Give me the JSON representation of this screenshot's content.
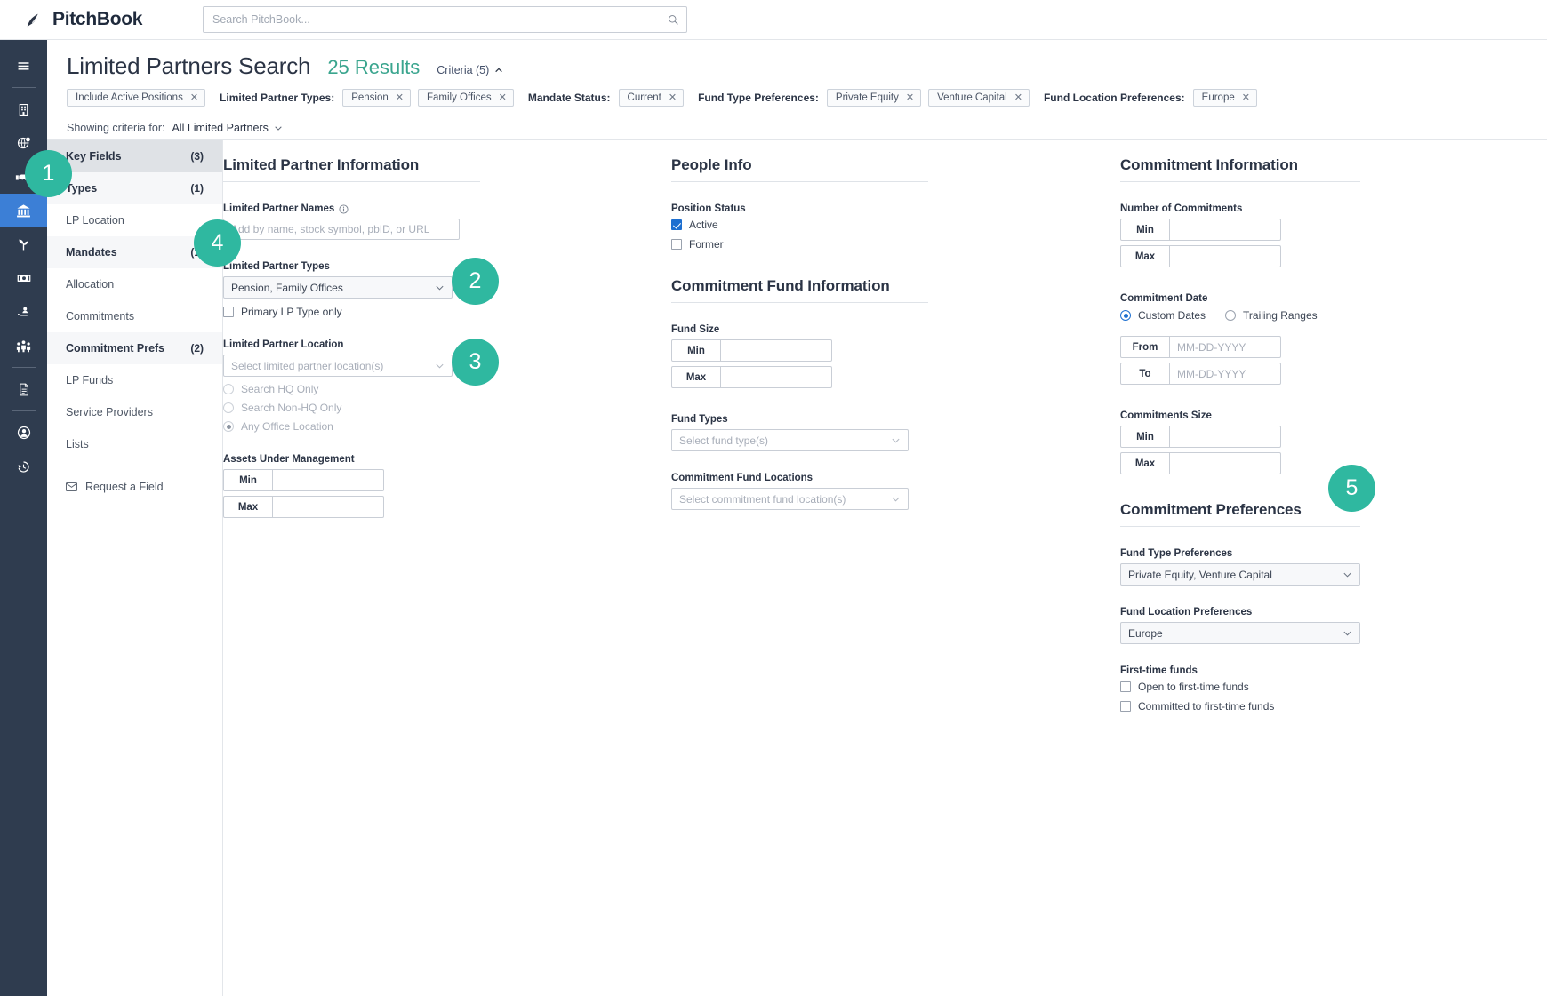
{
  "topbar": {
    "brand_name": "PitchBook",
    "search_placeholder": "Search PitchBook...",
    "search_value": ""
  },
  "rail": {
    "items": [
      {
        "icon": "hamburger-menu-icon",
        "active": false
      },
      {
        "icon": "company-building-icon",
        "active": false
      },
      {
        "icon": "globe-deals-icon",
        "active": false
      },
      {
        "icon": "handshake-icon",
        "active": false
      },
      {
        "icon": "bank-institution-icon",
        "active": true
      },
      {
        "icon": "sprout-plant-icon",
        "active": false
      },
      {
        "icon": "money-banknote-icon",
        "active": false
      },
      {
        "icon": "hand-person-advisor-icon",
        "active": false
      },
      {
        "icon": "people-group-icon",
        "active": false
      },
      {
        "icon": "document-file-icon",
        "active": false
      },
      {
        "icon": "user-profile-icon",
        "active": false
      },
      {
        "icon": "history-clock-icon",
        "active": false
      }
    ]
  },
  "header": {
    "page_title": "Limited Partners Search",
    "results_count": "25 Results",
    "criteria_toggle": "Criteria (5)",
    "chips": [
      {
        "type": "chip",
        "text": "Include Active Positions"
      },
      {
        "type": "label",
        "text": "Limited Partner Types:"
      },
      {
        "type": "chip",
        "text": "Pension"
      },
      {
        "type": "chip",
        "text": "Family Offices"
      },
      {
        "type": "label",
        "text": "Mandate Status:"
      },
      {
        "type": "chip",
        "text": "Current"
      },
      {
        "type": "label",
        "text": "Fund Type Preferences:"
      },
      {
        "type": "chip",
        "text": "Private Equity"
      },
      {
        "type": "chip",
        "text": "Venture Capital"
      },
      {
        "type": "label",
        "text": "Fund Location Preferences:"
      },
      {
        "type": "chip",
        "text": "Europe"
      }
    ]
  },
  "criteria_bar": {
    "prefix": "Showing criteria for:",
    "selected": "All Limited Partners"
  },
  "nav": {
    "items": [
      {
        "label": "Key Fields",
        "count": "(3)",
        "state": "selected",
        "bold": true
      },
      {
        "label": "Types",
        "count": "(1)",
        "state": "filled",
        "bold": true
      },
      {
        "label": "LP Location",
        "count": "",
        "state": "plain",
        "bold": false
      },
      {
        "label": "Mandates",
        "count": "(1)",
        "state": "filled",
        "bold": true
      },
      {
        "label": "Allocation",
        "count": "",
        "state": "plain",
        "bold": false
      },
      {
        "label": "Commitments",
        "count": "",
        "state": "plain",
        "bold": false
      },
      {
        "label": "Commitment Prefs",
        "count": "(2)",
        "state": "filled",
        "bold": true
      },
      {
        "label": "LP Funds",
        "count": "",
        "state": "plain",
        "bold": false
      },
      {
        "label": "Service Providers",
        "count": "",
        "state": "plain",
        "bold": false
      },
      {
        "label": "Lists",
        "count": "",
        "state": "plain",
        "bold": false
      }
    ],
    "request_field": "Request a Field"
  },
  "lp_info": {
    "section_title": "Limited Partner Information",
    "names_label": "Limited Partner Names",
    "names_placeholder": "Add by name, stock symbol, pbID, or URL",
    "names_value": "",
    "types_label": "Limited Partner Types",
    "types_value": "Pension, Family Offices",
    "primary_only_label": "Primary LP Type only",
    "primary_only_checked": false,
    "location_label": "Limited Partner Location",
    "location_placeholder": "Select limited partner location(s)",
    "location_radios": [
      {
        "label": "Search HQ Only",
        "selected": false
      },
      {
        "label": "Search Non-HQ Only",
        "selected": false
      },
      {
        "label": "Any Office Location",
        "selected": true
      }
    ],
    "aum_label": "Assets Under Management",
    "aum_min_label": "Min",
    "aum_min_value": "",
    "aum_max_label": "Max",
    "aum_max_value": ""
  },
  "people_info": {
    "section_title": "People Info",
    "position_status_label": "Position Status",
    "active_label": "Active",
    "active_checked": true,
    "former_label": "Former",
    "former_checked": false
  },
  "commitment_fund_info": {
    "section_title": "Commitment Fund Information",
    "fund_size_label": "Fund Size",
    "fund_size_min_label": "Min",
    "fund_size_min_value": "",
    "fund_size_max_label": "Max",
    "fund_size_max_value": "",
    "fund_types_label": "Fund Types",
    "fund_types_placeholder": "Select fund type(s)",
    "fund_locations_label": "Commitment Fund Locations",
    "fund_locations_placeholder": "Select commitment fund location(s)"
  },
  "commitment_info": {
    "section_title": "Commitment Information",
    "num_commitments_label": "Number of Commitments",
    "num_min_label": "Min",
    "num_min_value": "",
    "num_max_label": "Max",
    "num_max_value": "",
    "date_label": "Commitment Date",
    "date_mode_custom": "Custom Dates",
    "date_mode_trailing": "Trailing Ranges",
    "date_mode_selected": "Custom Dates",
    "from_label": "From",
    "from_placeholder": "MM-DD-YYYY",
    "from_value": "",
    "to_label": "To",
    "to_placeholder": "MM-DD-YYYY",
    "to_value": "",
    "size_label": "Commitments Size",
    "size_min_label": "Min",
    "size_min_value": "",
    "size_max_label": "Max",
    "size_max_value": ""
  },
  "commitment_prefs": {
    "section_title": "Commitment Preferences",
    "fund_type_label": "Fund Type Preferences",
    "fund_type_value": "Private Equity, Venture Capital",
    "fund_location_label": "Fund Location Preferences",
    "fund_location_value": "Europe",
    "first_time_label": "First-time funds",
    "open_label": "Open to first-time funds",
    "open_checked": false,
    "committed_label": "Committed to first-time funds",
    "committed_checked": false
  },
  "callouts": [
    {
      "num": "1"
    },
    {
      "num": "2"
    },
    {
      "num": "3"
    },
    {
      "num": "4"
    },
    {
      "num": "5"
    }
  ],
  "colors": {
    "accent_teal": "#2fb8a0",
    "results_green": "#3aa58e",
    "rail_bg": "#2f3c4f",
    "rail_active": "#3c7fd6",
    "checkbox_blue": "#1d6fd0"
  }
}
